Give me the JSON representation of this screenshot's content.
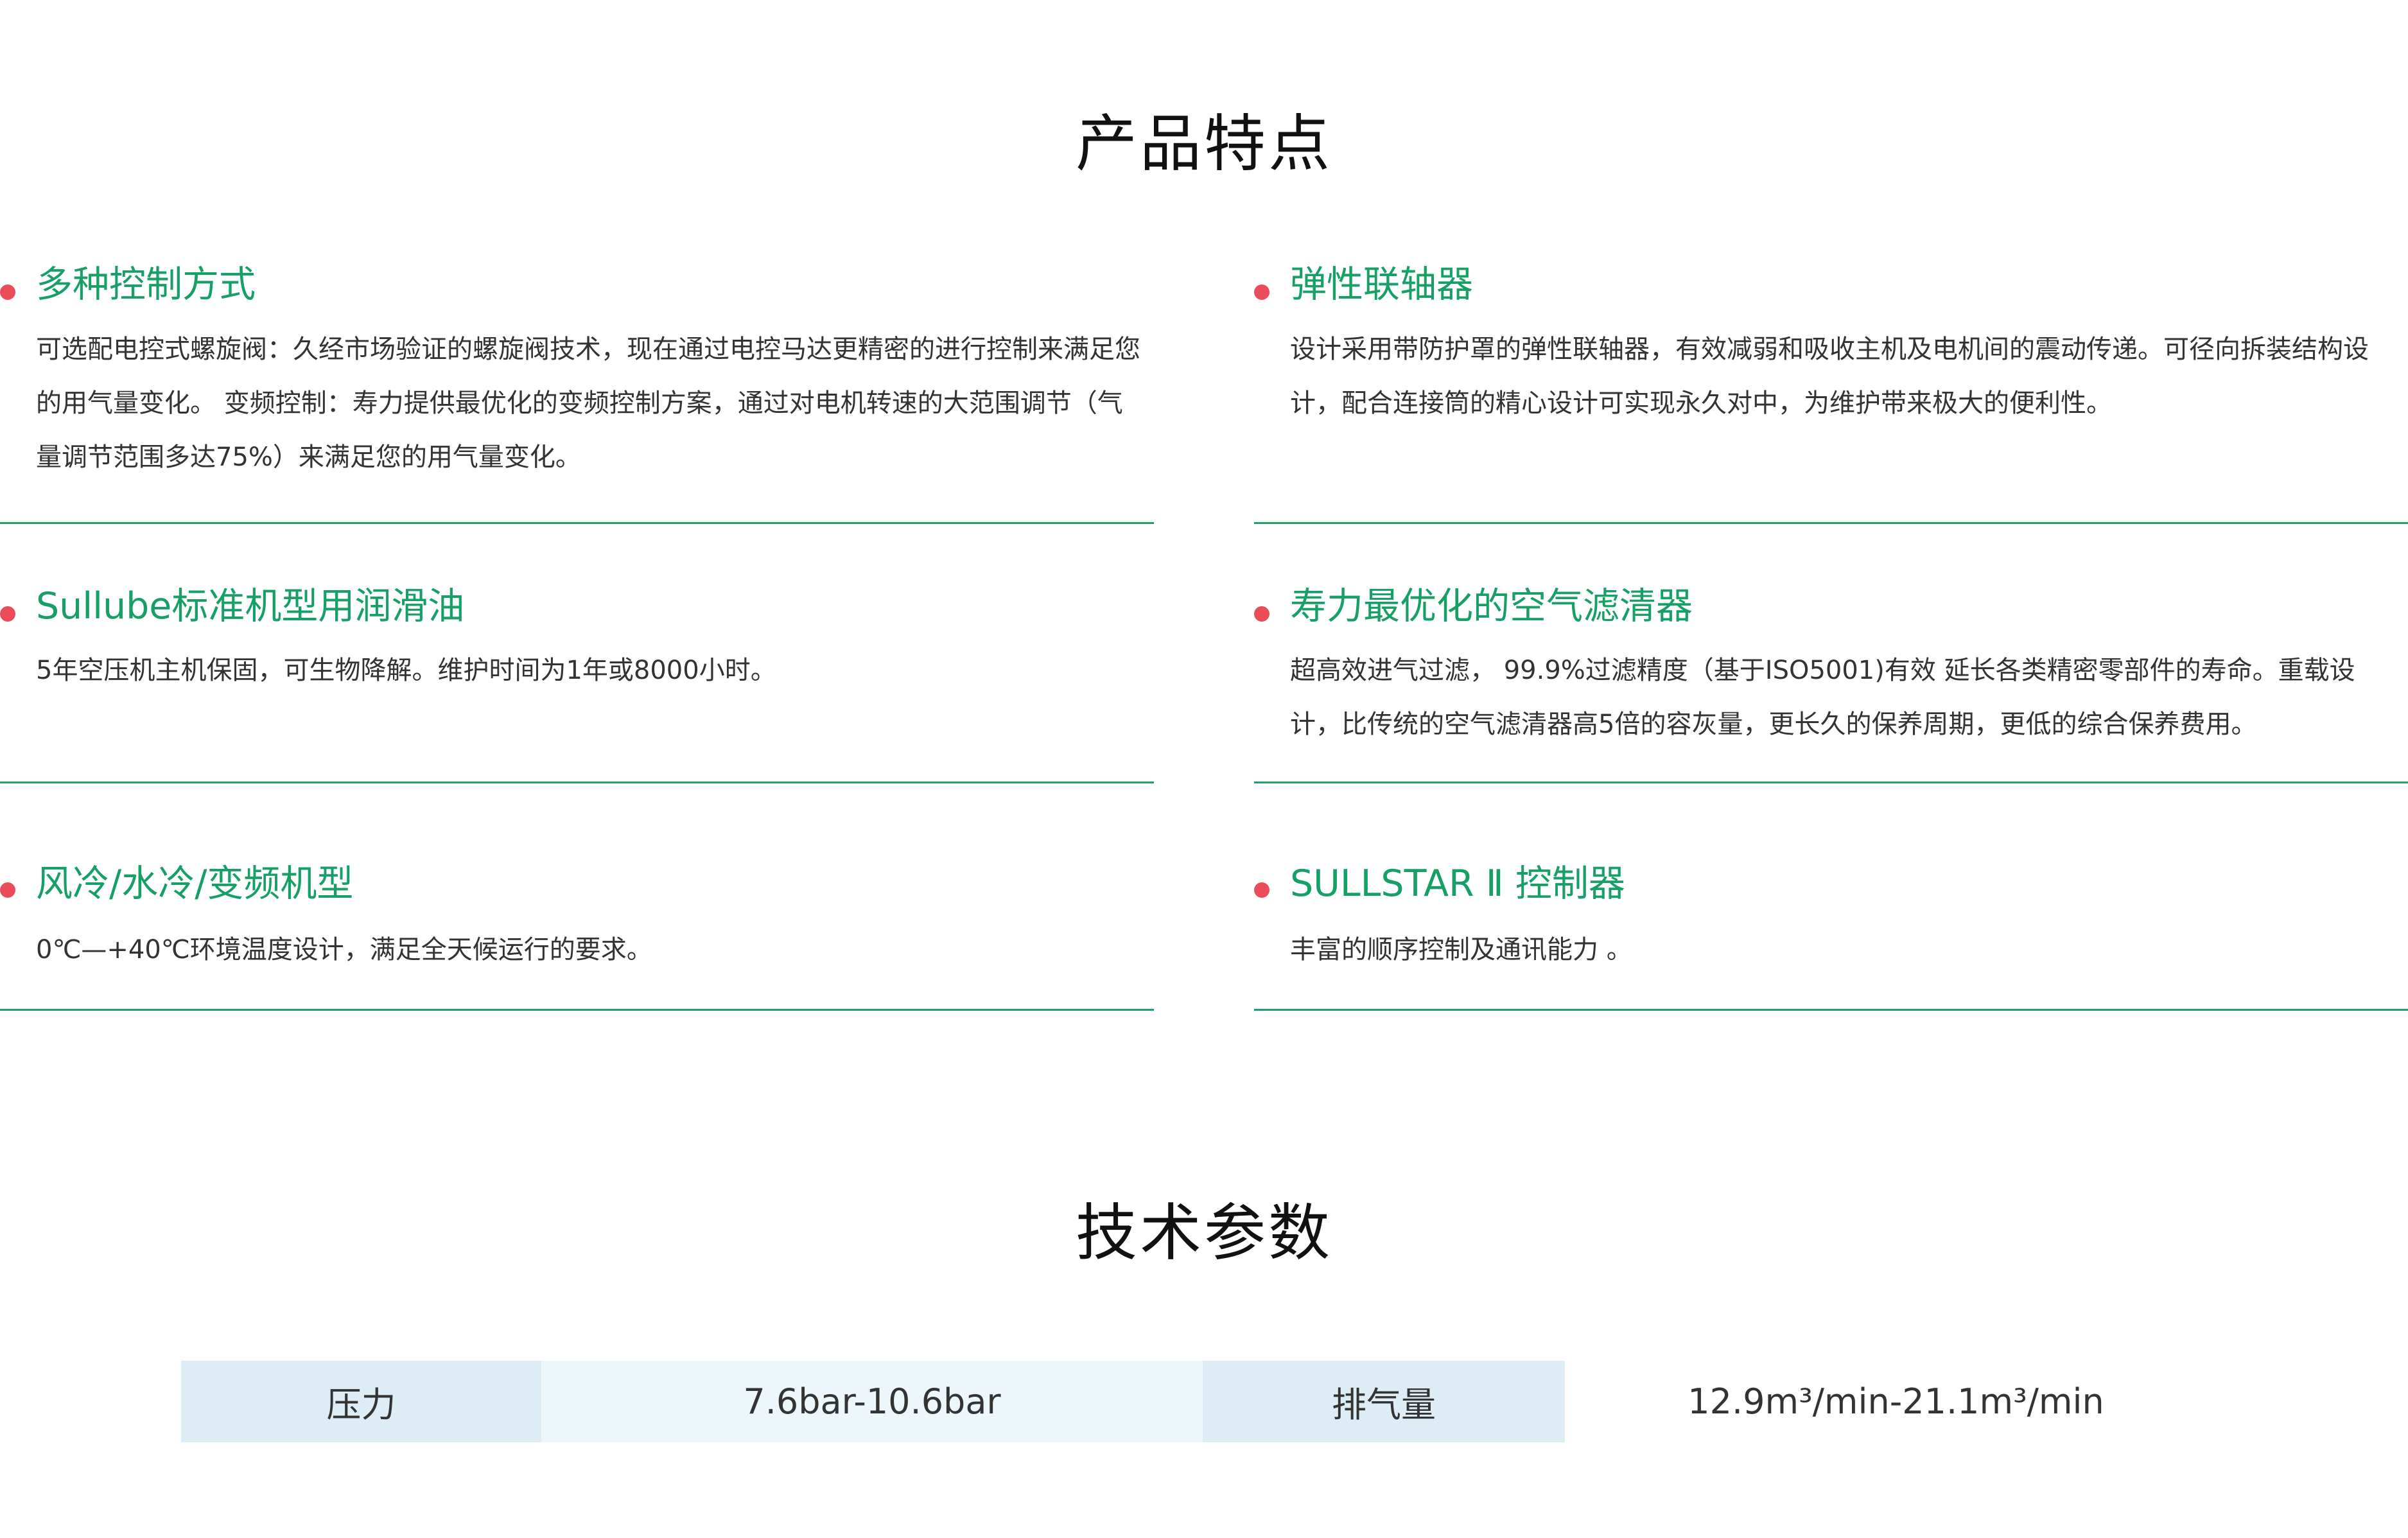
{
  "features": {
    "title": "产品特点",
    "items": [
      {
        "title": "多种控制方式",
        "desc": "可选配电控式螺旋阀：久经市场验证的螺旋阀技术，现在通过电控马达更精密的进行控制来满足您的用气量变化。 变频控制：寿力提供最优化的变频控制方案，通过对电机转速的大范围调节（气量调节范围多达75%）来满足您的用气量变化。"
      },
      {
        "title": "弹性联轴器",
        "desc": "设计采用带防护罩的弹性联轴器，有效减弱和吸收主机及电机间的震动传递。可径向拆装结构设计，配合连接筒的精心设计可实现永久对中，为维护带来极大的便利性。"
      },
      {
        "title": "Sullube标准机型用润滑油",
        "desc": "5年空压机主机保固，可生物降解。维护时间为1年或8000小时。"
      },
      {
        "title": "寿力最优化的空气滤清器",
        "desc": "超高效进气过滤， 99.9%过滤精度（基于ISO5001)有效 延长各类精密零部件的寿命。重载设计，比传统的空气滤清器高5倍的容灰量，更长久的保养周期，更低的综合保养费用。"
      },
      {
        "title": "风冷/水冷/变频机型",
        "desc": "0℃—+40℃环境温度设计，满足全天候运行的要求。"
      },
      {
        "title": "SULLSTAR Ⅱ 控制器",
        "desc": "丰富的顺序控制及通讯能力 。"
      }
    ]
  },
  "specs": {
    "title": "技术参数",
    "rows": [
      {
        "label1": "压力",
        "value1": "7.6bar-10.6bar",
        "label2": "排气量",
        "value2": "12.9m³/min-21.1m³/min"
      }
    ]
  },
  "colors": {
    "accent_green": "#16a065",
    "divider_green": "#1fa06b",
    "bullet_red": "#ea4d59",
    "table_label_bg": "#ddecf5",
    "table_value_bg": "#edf6fa"
  }
}
